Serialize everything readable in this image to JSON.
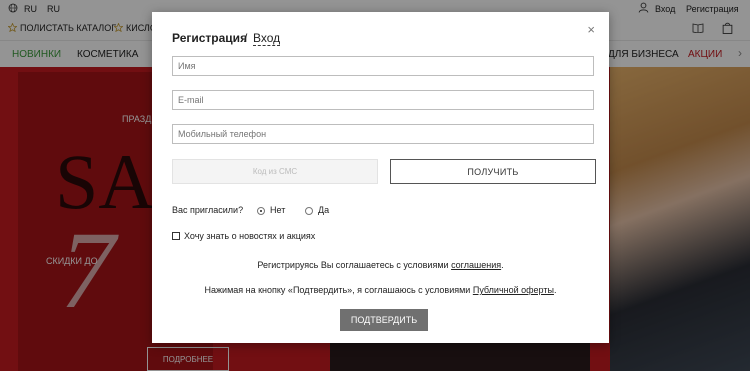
{
  "topbar": {
    "lang1": "RU",
    "lang2": "RU",
    "catalog": "ПОЛИСТАТЬ КАТАЛОГ",
    "promo": "КИСЛО",
    "login": "Вход",
    "register": "Регистрация"
  },
  "nav": {
    "new": "НОВИНКИ",
    "cosmetics": "КОСМЕТИКА",
    "business": "ДЛЯ БИЗНЕСА",
    "sale": "АКЦИИ"
  },
  "hero": {
    "holiday": "ПРАЗД",
    "big_s": "SA",
    "big_7": "7",
    "discount": "СКИДКИ ДО",
    "more": "ПОДРОБНЕЕ"
  },
  "modal": {
    "title": "Регистрация",
    "separator": "/",
    "login_link": "Вход",
    "close": "×",
    "name_placeholder": "Имя",
    "email_placeholder": "E-mail",
    "phone_placeholder": "Мобильный телефон",
    "sms_placeholder": "Код из СМС",
    "get_button": "ПОЛУЧИТЬ",
    "invited_question": "Вас пригласили?",
    "option_no": "Нет",
    "option_yes": "Да",
    "news_checkbox": "Хочу знать о новостях и акциях",
    "agreement_text": "Регистрируясь Вы соглашаетесь с условиями",
    "agreement_link": "соглашения",
    "agreement_end": ".",
    "offer_text": "Нажимая на кнопку «Подтвердить», я соглашаюсь с условиями",
    "offer_link": "Публичной оферты",
    "offer_end": ".",
    "confirm_button": "ПОДТВЕРДИТЬ"
  },
  "colors": {
    "accent_green": "#3a9a3a",
    "sale_red": "#c41b1f",
    "button_gray": "#707070"
  }
}
